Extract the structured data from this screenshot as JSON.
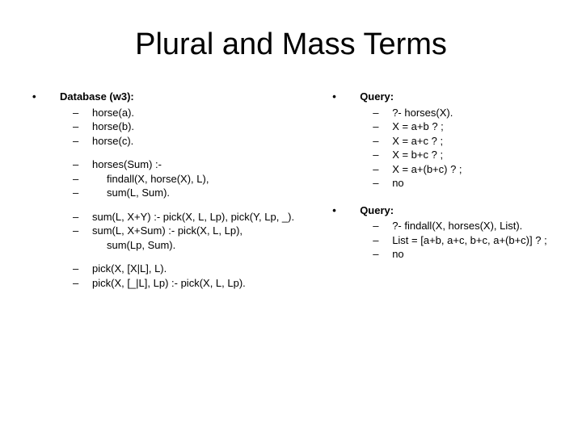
{
  "title": "Plural and Mass Terms",
  "left": {
    "heading": "Database (w3):",
    "g1": [
      "horse(a).",
      "horse(b).",
      "horse(c)."
    ],
    "g2": [
      "horses(Sum) :-",
      "findall(X, horse(X), L),",
      "sum(L, Sum)."
    ],
    "g3": [
      "sum(L, X+Y) :- pick(X, L, Lp), pick(Y, Lp, _).",
      "sum(L, X+Sum) :- pick(X, L, Lp),",
      "sum(Lp, Sum)."
    ],
    "g4": [
      "pick(X, [X|L], L).",
      "pick(X, [_|L], Lp) :- pick(X, L, Lp)."
    ]
  },
  "right": {
    "q1": {
      "heading": "Query:",
      "lines": [
        "?- horses(X).",
        "X = a+b ? ;",
        "X = a+c ? ;",
        "X = b+c ? ;",
        "X = a+(b+c) ? ;",
        "no"
      ]
    },
    "q2": {
      "heading": "Query:",
      "lines": [
        "?- findall(X, horses(X), List).",
        "List = [a+b, a+c, b+c, a+(b+c)] ? ;",
        "no"
      ]
    }
  }
}
